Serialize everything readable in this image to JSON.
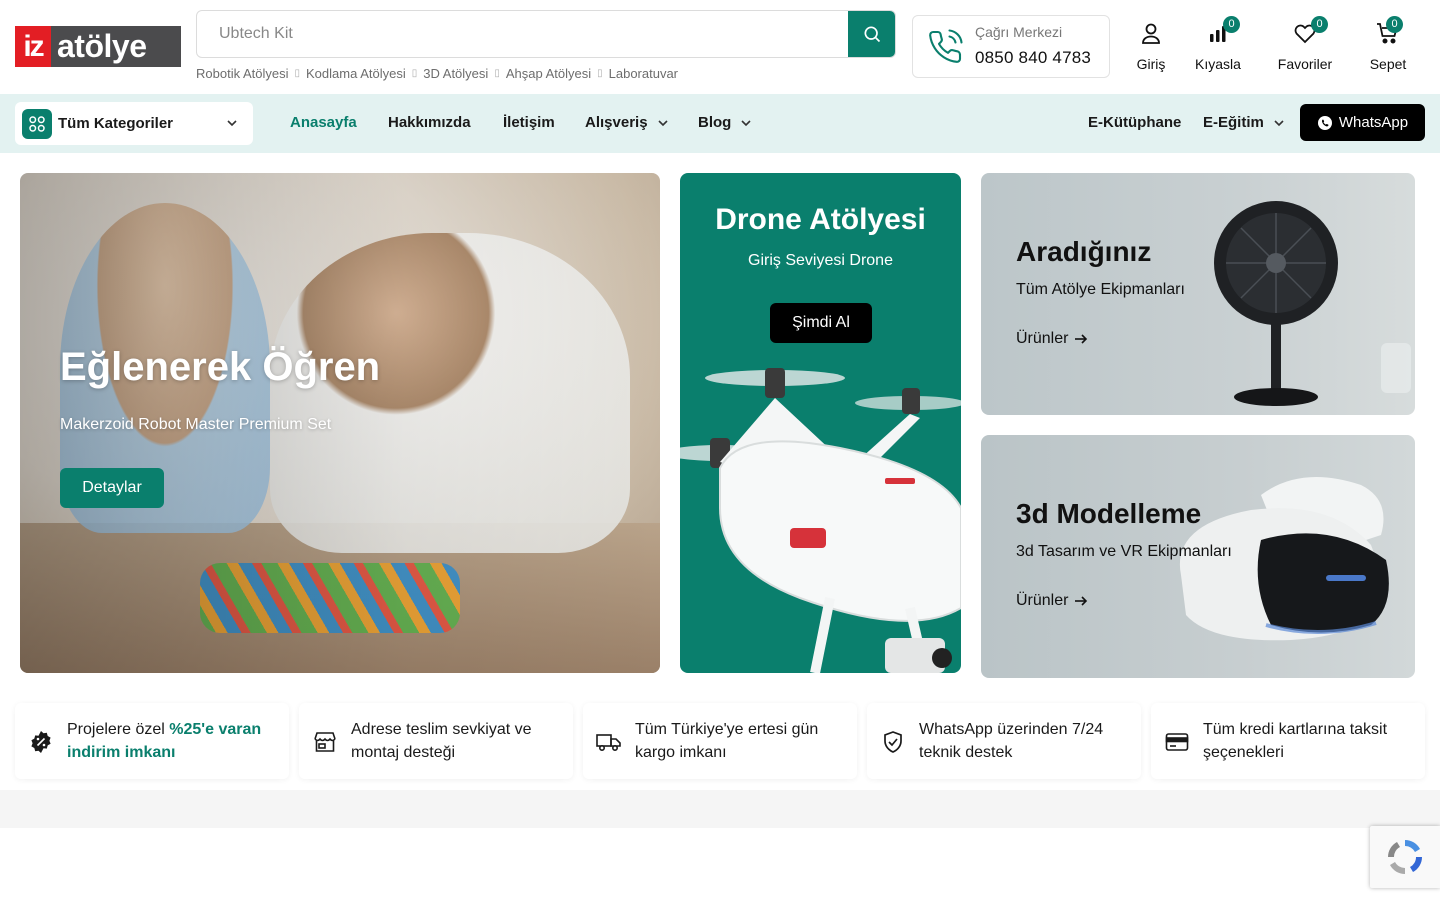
{
  "logo": {
    "part1": "iz",
    "part2": "atölye"
  },
  "search": {
    "placeholder": "Ubtech Kit"
  },
  "quick_links": [
    "Robotik Atölyesi",
    "Kodlama Atölyesi",
    "3D Atölyesi",
    "Ahşap Atölyesi",
    "Laboratuvar"
  ],
  "call_center": {
    "label": "Çağrı Merkezi",
    "number": "0850 840 4783"
  },
  "header_icons": {
    "login": "Giriş",
    "compare": {
      "label": "Kıyasla",
      "count": "0"
    },
    "favorites": {
      "label": "Favoriler",
      "count": "0"
    },
    "cart": {
      "label": "Sepet",
      "count": "0"
    }
  },
  "nav": {
    "categories": "Tüm Kategoriler",
    "items": [
      "Anasayfa",
      "Hakkımızda",
      "İletişim",
      "Alışveriş",
      "Blog"
    ],
    "right_items": [
      "E-Kütüphane",
      "E-Eğitim"
    ],
    "whatsapp": "WhatsApp"
  },
  "hero": {
    "title": "Eğlenerek Öğren",
    "subtitle": "Makerzoid Robot Master Premium Set",
    "button": "Detaylar"
  },
  "drone": {
    "title": "Drone Atölyesi",
    "subtitle": "Giriş Seviyesi Drone",
    "button": "Şimdi Al"
  },
  "side_banners": [
    {
      "title": "Aradığınız",
      "subtitle": "Tüm Atölye Ekipmanları",
      "link": "Ürünler"
    },
    {
      "title": "3d Modelleme",
      "subtitle": "3d Tasarım ve VR Ekipmanları",
      "link": "Ürünler"
    }
  ],
  "features": [
    {
      "pre": "Projelere özel ",
      "highlight": "%25'e varan indirim imkanı",
      "icon": "discount-badge-icon"
    },
    {
      "text": "Adrese teslim sevkiyat ve montaj desteği",
      "icon": "store-icon"
    },
    {
      "text": "Tüm Türkiye'ye ertesi gün kargo imkanı",
      "icon": "truck-icon"
    },
    {
      "text": "WhatsApp üzerinden 7/24 teknik destek",
      "icon": "shield-check-icon"
    },
    {
      "text": "Tüm kredi kartlarına taksit şeçenekleri",
      "icon": "credit-card-icon"
    }
  ],
  "colors": {
    "brand": "#0a7f6d",
    "nav_bg": "#e3f2f1",
    "logo_red": "#e31e24",
    "logo_gray": "#4b4b4d"
  }
}
